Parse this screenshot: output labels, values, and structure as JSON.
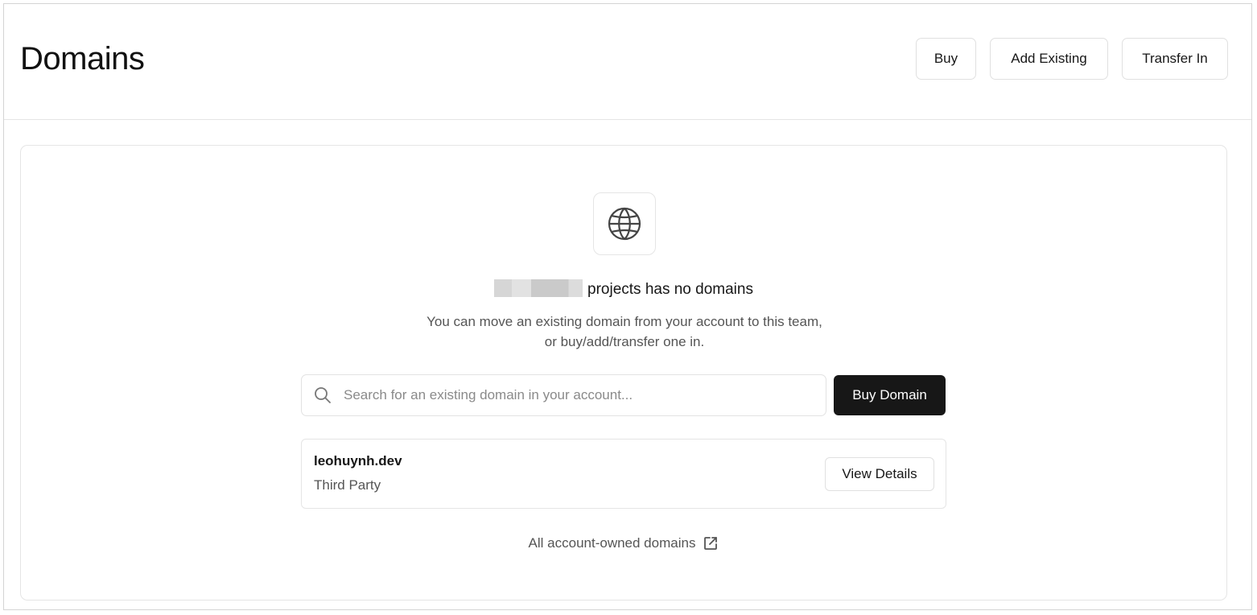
{
  "header": {
    "title": "Domains",
    "buttons": {
      "buy": "Buy",
      "add_existing": "Add Existing",
      "transfer_in": "Transfer In"
    }
  },
  "empty_state": {
    "icon": "globe-icon",
    "title_suffix": "projects has no domains",
    "description": "You can move an existing domain from your account to this team, or buy/add/transfer one in."
  },
  "search": {
    "placeholder": "Search for an existing domain in your account...",
    "value": "",
    "icon": "search-icon"
  },
  "buy_domain_label": "Buy Domain",
  "domains": [
    {
      "name": "leohuynh.dev",
      "type": "Third Party",
      "action_label": "View Details"
    }
  ],
  "footer_link": {
    "label": "All account-owned domains",
    "icon": "external-link-icon"
  },
  "colors": {
    "primary_button_bg": "#171717",
    "border": "#e5e5e5",
    "muted_text": "#555555"
  }
}
